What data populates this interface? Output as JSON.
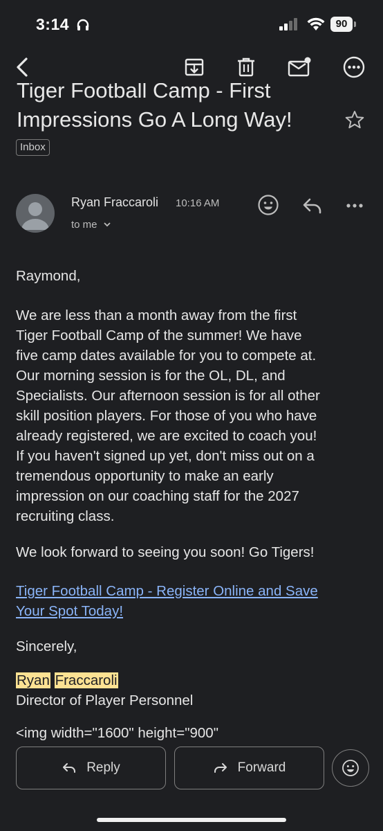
{
  "status_bar": {
    "time": "3:14",
    "battery": "90"
  },
  "email": {
    "subject_line1": "Tiger Football Camp - First",
    "subject_line2": "Impressions Go A Long Way!",
    "label": "Inbox",
    "sender": "Ryan Fraccaroli",
    "time": "10:16 AM",
    "recipient": "to me",
    "greeting": "Raymond,",
    "paragraph": [
      "We are less than a month away from the first",
      "Tiger Football Camp of the summer! We have",
      "five camp dates available for you to compete at.",
      "Our morning session is for the OL, DL, and",
      "Specialists. Our afternoon session is for all other",
      "skill position players. For those of you who have",
      "already registered, we are excited to coach you!",
      "If you haven't signed up yet, don't miss out on a",
      "tremendous opportunity to make an early",
      "impression on our coaching staff for the 2027",
      "recruiting class."
    ],
    "closing_line": "We look forward to seeing you soon! Go Tigers!",
    "link_line1": "Tiger Football Camp - Register Online and Save",
    "link_line2": "Your Spot Today!",
    "signoff": "Sincerely,",
    "sig_first": "Ryan",
    "sig_last": "Fraccaroli",
    "sig_title": "Director of Player Personnel",
    "raw_html": "<img width=\"1600\" height=\"900\""
  },
  "actions": {
    "reply": "Reply",
    "forward": "Forward"
  }
}
